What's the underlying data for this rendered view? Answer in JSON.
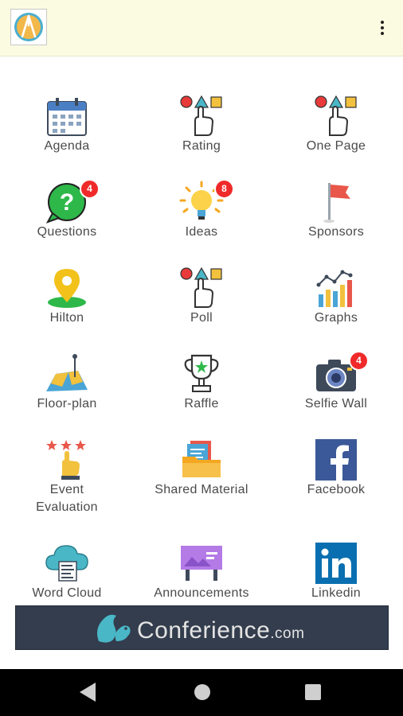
{
  "app": {
    "logo": "conference-app-logo",
    "menu_icon": "more-vert-icon"
  },
  "tiles": [
    {
      "label": "Agenda",
      "icon": "calendar-icon"
    },
    {
      "label": "Rating",
      "icon": "shapes-hand-icon"
    },
    {
      "label": "One Page",
      "icon": "shapes-hand-icon"
    },
    {
      "label": "Questions",
      "icon": "question-bubble-icon",
      "badge": "4"
    },
    {
      "label": "Ideas",
      "icon": "lightbulb-icon",
      "badge": "8"
    },
    {
      "label": "Sponsors",
      "icon": "flag-icon"
    },
    {
      "label": "Hilton",
      "icon": "map-pin-icon"
    },
    {
      "label": "Poll",
      "icon": "shapes-hand-icon"
    },
    {
      "label": "Graphs",
      "icon": "bar-chart-icon"
    },
    {
      "label": "Floor-plan",
      "icon": "map-icon"
    },
    {
      "label": "Raffle",
      "icon": "trophy-icon"
    },
    {
      "label": "Selfie Wall",
      "icon": "camera-icon",
      "badge": "4"
    },
    {
      "label": "Event\nEvaluation",
      "icon": "stars-hand-icon"
    },
    {
      "label": "Shared Material",
      "icon": "folder-icon"
    },
    {
      "label": "Facebook",
      "icon": "facebook-icon"
    },
    {
      "label": "Word Cloud",
      "icon": "cloud-icon"
    },
    {
      "label": "Announcements",
      "icon": "billboard-icon"
    },
    {
      "label": "Linkedin",
      "icon": "linkedin-icon"
    }
  ],
  "banner": {
    "brand": "Conferience",
    "suffix": ".com"
  },
  "colors": {
    "appbar": "#fbfbe1",
    "badge": "#f02a2a",
    "banner": "#333d4d",
    "navbar": "#000000"
  }
}
